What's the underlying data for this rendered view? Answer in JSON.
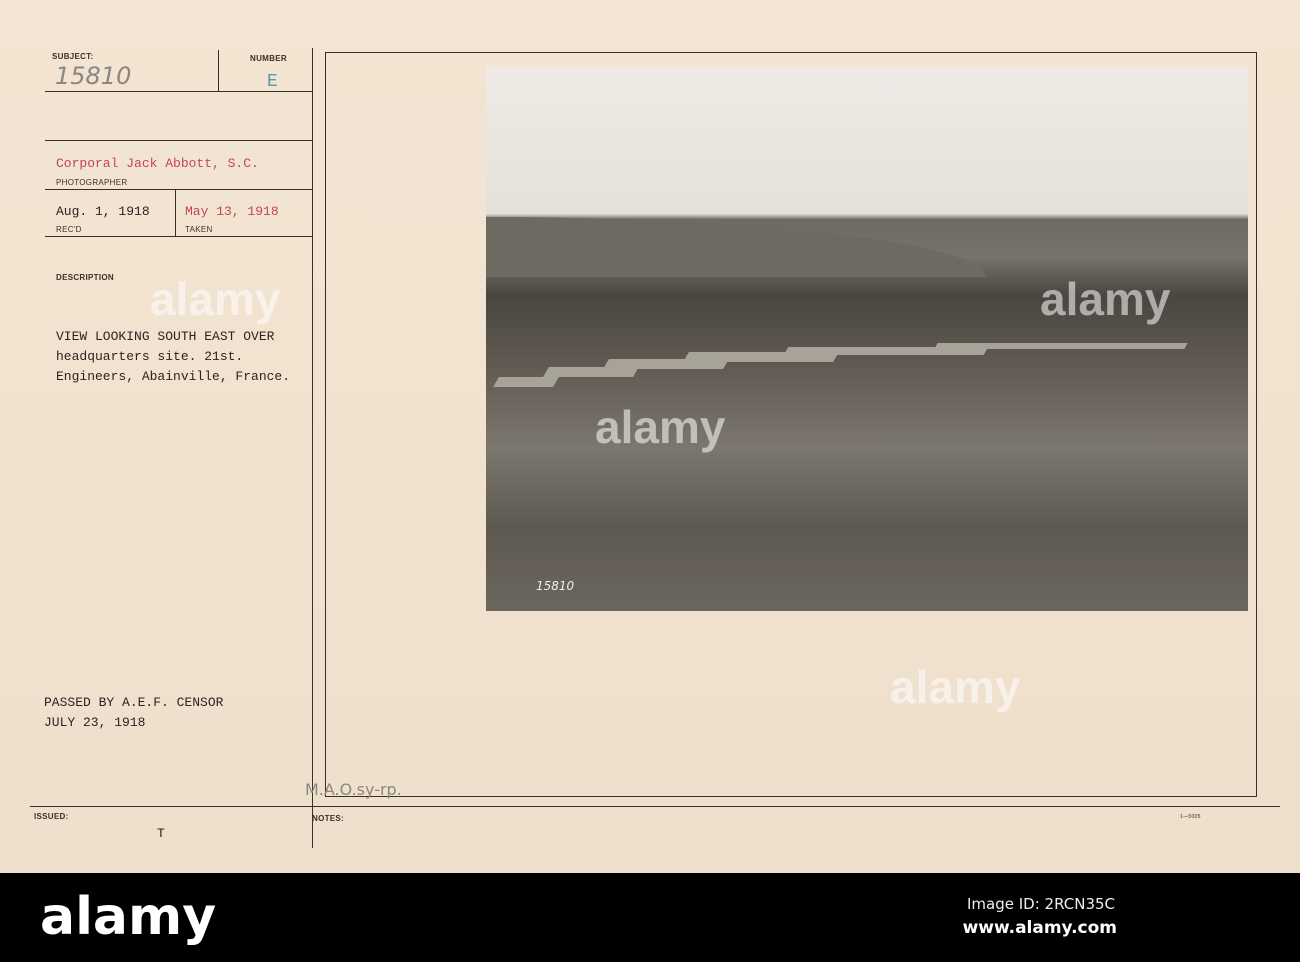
{
  "card": {
    "subject_label": "SUBJECT:",
    "subject_value": "15810",
    "number_label": "NUMBER",
    "number_value": "E",
    "photographer": "Corporal Jack Abbott, S.C.",
    "photographer_label": "PHOTOGRAPHER",
    "received": "Aug. 1, 1918",
    "received_label": "REC'D",
    "taken": "May 13, 1918",
    "taken_label": "TAKEN",
    "description_label": "DESCRIPTION",
    "description_lines": [
      "VIEW LOOKING SOUTH EAST OVER",
      "headquarters site. 21st.",
      "Engineers, Abainville, France."
    ],
    "censor_lines": [
      "PASSED BY A.E.F. CENSOR",
      "JULY 23, 1918"
    ],
    "issued_label": "ISSUED:",
    "issued_value": "T",
    "notes_label": "NOTES:",
    "notes_handwritten": "M.A.O.sy-rp.",
    "form_code": "1—5005",
    "photo_number": "15810"
  },
  "watermark": {
    "text": "alamy"
  },
  "footer": {
    "logo": "alamy",
    "image_id": "Image ID: 2RCN35C",
    "site": "www.alamy.com"
  }
}
